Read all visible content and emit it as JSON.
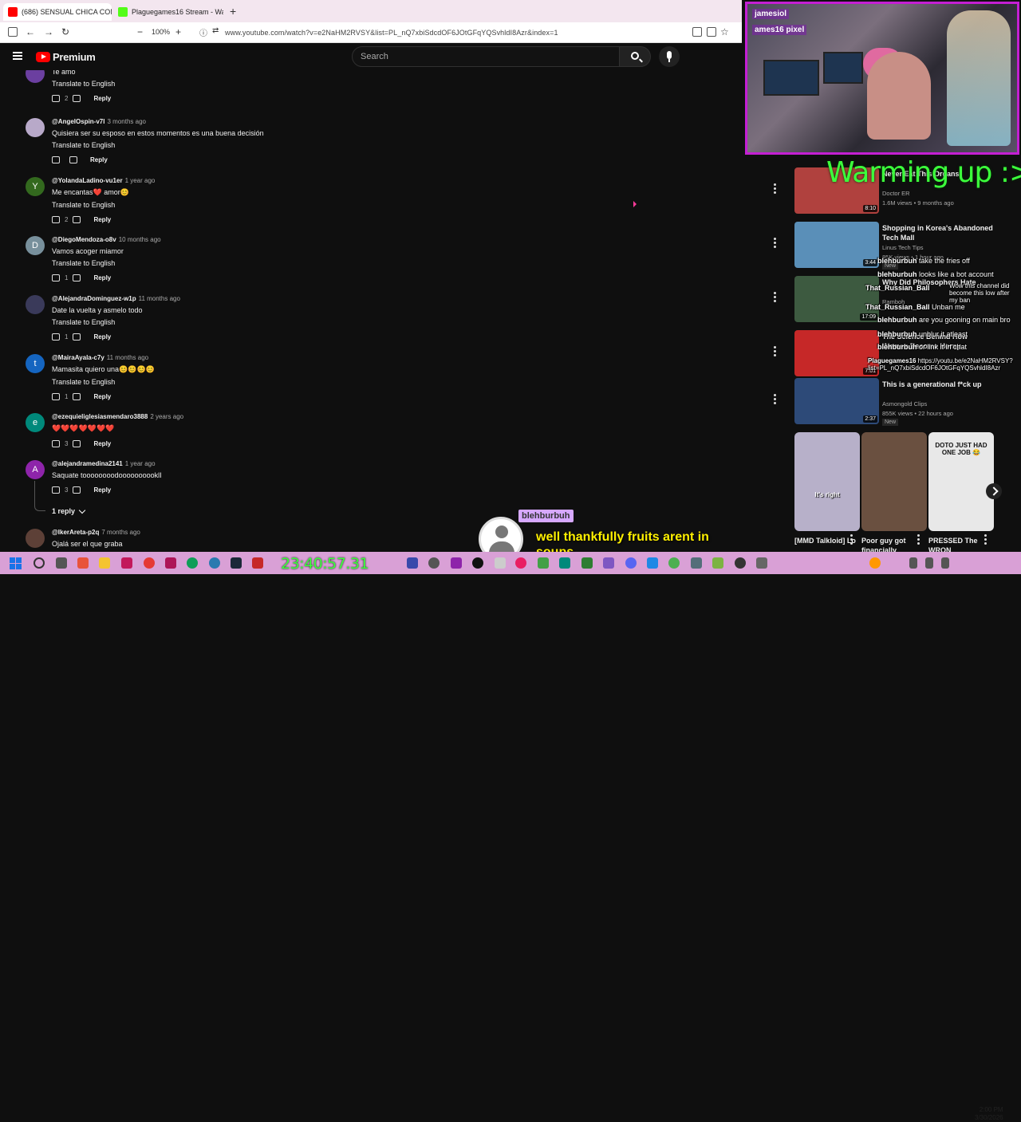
{
  "browser": {
    "tabs": [
      {
        "title": "(686) SENSUAL CHICA CON TA",
        "favicon_color": "#ff0000"
      },
      {
        "title": "Plaguegames16 Stream - Watch",
        "favicon_color": "#53fc18"
      }
    ],
    "zoom": "100%",
    "url": "www.youtube.com/watch?v=e2NaHM2RVSY&list=PL_nQ7xbiSdcdOF6JOtGFqYQSvhldI8Azr&index=1"
  },
  "youtube": {
    "logo_text": "Premium",
    "search_placeholder": "Search"
  },
  "comments": [
    {
      "handle": "",
      "time": "",
      "text": "Te amo",
      "translate": "Translate to English",
      "likes": "2",
      "reply": "Reply",
      "avatar_letter": "",
      "avatar_color": "#6b3fa0"
    },
    {
      "handle": "@AngelOspin-v7l",
      "time": "3 months ago",
      "text": "Quisiera ser su esposo en estos momentos es una buena decisión",
      "translate": "Translate to English",
      "likes": "",
      "reply": "Reply",
      "avatar_letter": "",
      "avatar_color": "#b8a9c9"
    },
    {
      "handle": "@YolandaLadino-vu1er",
      "time": "1 year ago",
      "text": "Me encantas❤️ amor😊",
      "translate": "Translate to English",
      "likes": "2",
      "reply": "Reply",
      "avatar_letter": "Y",
      "avatar_color": "#33691e"
    },
    {
      "handle": "@DiegoMendoza-o8v",
      "time": "10 months ago",
      "text": "Vamos acoger miamor",
      "translate": "Translate to English",
      "likes": "1",
      "reply": "Reply",
      "avatar_letter": "D",
      "avatar_color": "#78909c"
    },
    {
      "handle": "@AlejandraDominguez-w1p",
      "time": "11 months ago",
      "text": "Date la vuelta y asmelo todo",
      "translate": "Translate to English",
      "likes": "1",
      "reply": "Reply",
      "avatar_letter": "",
      "avatar_color": "#3a3a5a"
    },
    {
      "handle": "@MairaAyala-c7y",
      "time": "11 months ago",
      "text": "Mamasita quiero una😊😊😊😊",
      "translate": "Translate to English",
      "likes": "1",
      "reply": "Reply",
      "avatar_letter": "t",
      "avatar_color": "#1565c0"
    },
    {
      "handle": "@ezequieliglesiasmendaro3888",
      "time": "2 years ago",
      "text": "❤️❤️❤️❤️❤️❤️❤️",
      "translate": "",
      "likes": "3",
      "reply": "Reply",
      "avatar_letter": "e",
      "avatar_color": "#00897b"
    },
    {
      "handle": "@alejandramedina2141",
      "time": "1 year ago",
      "text": "Saquate toooooooodoooooooooklI",
      "translate": "",
      "likes": "3",
      "reply": "Reply",
      "avatar_letter": "A",
      "avatar_color": "#8e24aa"
    },
    {
      "handle": "@IkerAreta-p2q",
      "time": "7 months ago",
      "text": "Ojalá ser el que graba",
      "translate": "",
      "likes": "",
      "reply": "",
      "avatar_letter": "",
      "avatar_color": "#5d4037"
    }
  ],
  "replies_toggle": "1 reply",
  "webcam": {
    "handle1": "jamesiol",
    "handle2": "ames16 pixel"
  },
  "overlay": {
    "warming": "Warming up :>.<"
  },
  "recommendations": [
    {
      "title": "Never Eat This Organs",
      "channel": "Doctor ER",
      "meta": "1.6M views • 9 months ago",
      "duration": "8:10",
      "thumb_color": "#b0413e",
      "new": ""
    },
    {
      "title": "Shopping in Korea's Abandoned Tech Mall",
      "channel": "Linus Tech Tips",
      "meta": "85K views • 1 hour ago",
      "duration": "3:44",
      "thumb_color": "#5a8fb8",
      "new": "New"
    },
    {
      "title": "Why Did Philosophers Hate",
      "channel": "Ramboh",
      "meta": "",
      "duration": "17:09",
      "thumb_color": "#3d5a40",
      "new": ""
    },
    {
      "title": "The Science Behind How Women Become Horny",
      "channel": "",
      "meta": "",
      "duration": "7:01",
      "thumb_color": "#c62828",
      "new": ""
    },
    {
      "title": "This is a generational f*ck up",
      "channel": "Asmongold Clips",
      "meta": "855K views • 22 hours ago",
      "duration": "2:37",
      "thumb_color": "#2d4a78",
      "new": "New"
    }
  ],
  "thumb_texts": {
    "durations_top": "17:11",
    "eat": "EAT",
    "global": "global backla"
  },
  "shorts": [
    {
      "title": "[MMD Talkloid] Lo",
      "color": "#b7b0c9",
      "overlay": "It's right"
    },
    {
      "title": "Poor guy got financially",
      "color": "#6a5040",
      "overlay": ""
    },
    {
      "title": "PRESSED The WRON",
      "color": "#e8e8e8",
      "overlay": "DOTO JUST HAD ONE JOB 😂"
    }
  ],
  "chat": [
    {
      "name": "blehburbuh",
      "msg": "take the fries off"
    },
    {
      "name": "blehburbuh",
      "msg": "looks like a bot account"
    },
    {
      "name": "",
      "msg": "Wow this channel did become this low after my ban"
    },
    {
      "name": "That_Russian_Ball",
      "msg": ""
    },
    {
      "name": "That_Russian_Ball",
      "msg": "Unban me"
    },
    {
      "name": "blehburbuh",
      "msg": "are you gooning on main bro"
    },
    {
      "name": "blehburbuh",
      "msg": "unblur it atleast"
    },
    {
      "name": "blehburbuh",
      "msg": "or link it in chat"
    },
    {
      "name": "Plaguegames16",
      "msg": "https://youtu.be/e2NaHM2RVSY?list=PL_nQ7xbiSdcdOF6JOtGFqYQSvhldI8Azr"
    }
  ],
  "tts": {
    "name": "blehburbuh",
    "message": "well thankfully fruits arent in soups"
  },
  "taskbar": {
    "stream_clock": "23:40:57.31",
    "time": "2:00 PM",
    "date": "3/30/2026"
  }
}
